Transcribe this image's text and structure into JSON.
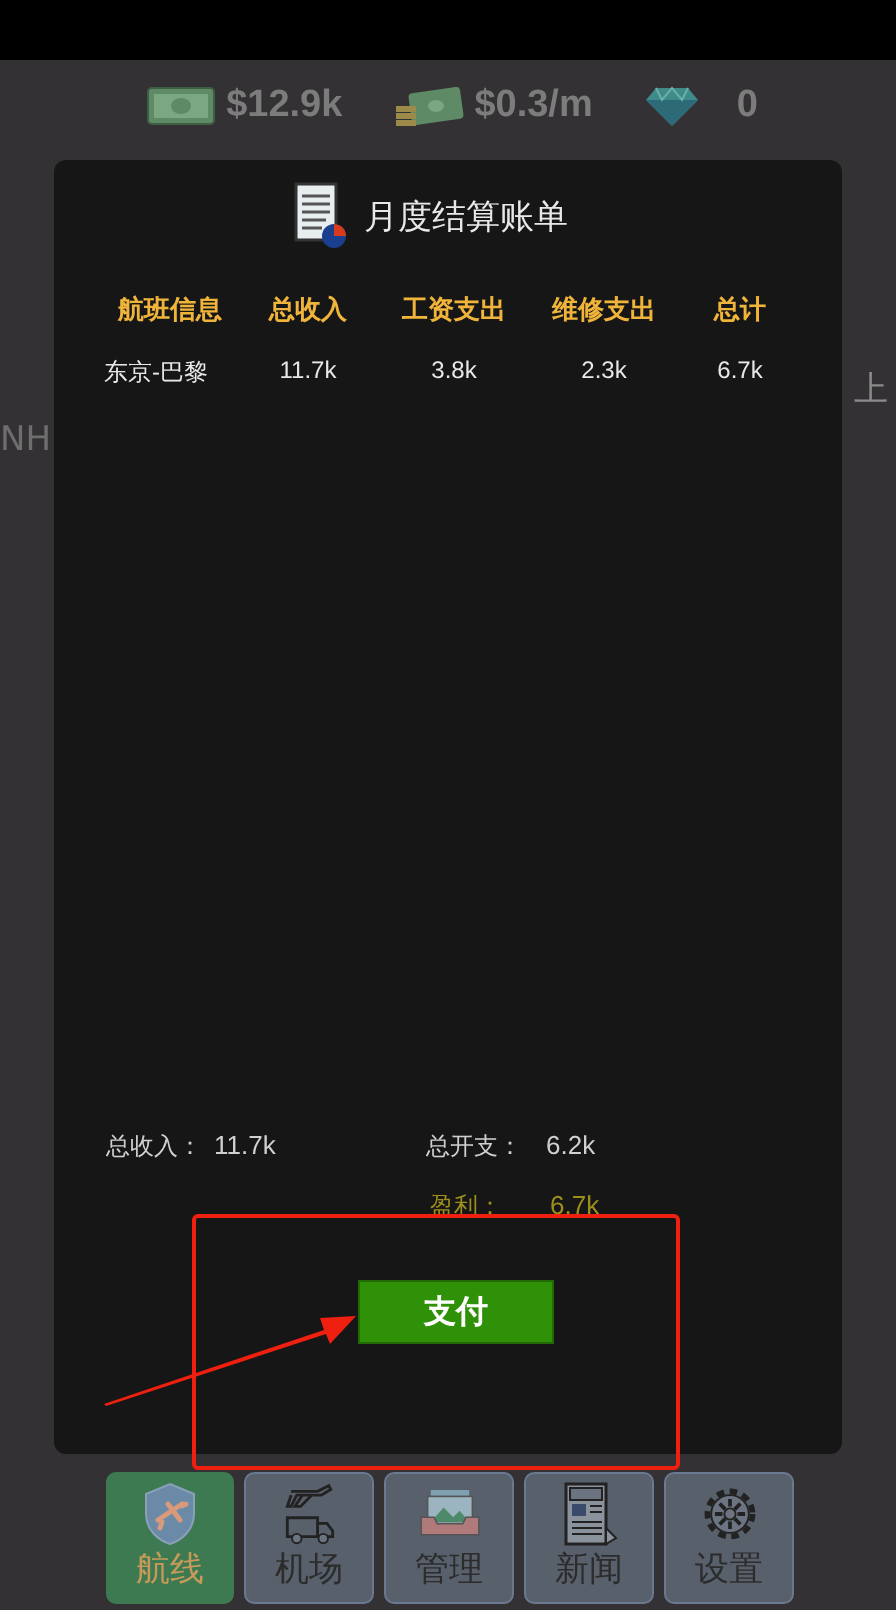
{
  "stats": [
    {
      "kind": "cash",
      "value": "$12.9k"
    },
    {
      "kind": "income",
      "value": "$0.3/m"
    },
    {
      "kind": "gem",
      "value": "0"
    }
  ],
  "background_texts": {
    "left": "NH",
    "right": "上"
  },
  "dialog": {
    "title": "月度结算账单",
    "columns": [
      "航班信息",
      "总收入",
      "工资支出",
      "维修支出",
      "总计"
    ],
    "rows": [
      [
        "东京-巴黎",
        "11.7k",
        "3.8k",
        "2.3k",
        "6.7k"
      ]
    ],
    "summary": {
      "income_label": "总收入：",
      "income": "11.7k",
      "expense_label": "总开支：",
      "expense": "6.2k",
      "profit_label": "盈利：",
      "profit": "6.7k"
    },
    "pay_button": "支付"
  },
  "nav": [
    {
      "kind": "routes",
      "label": "航线",
      "selected": true
    },
    {
      "kind": "airport",
      "label": "机场",
      "selected": false
    },
    {
      "kind": "manage",
      "label": "管理",
      "selected": false
    },
    {
      "kind": "news",
      "label": "新闻",
      "selected": false
    },
    {
      "kind": "settings",
      "label": "设置",
      "selected": false
    }
  ]
}
